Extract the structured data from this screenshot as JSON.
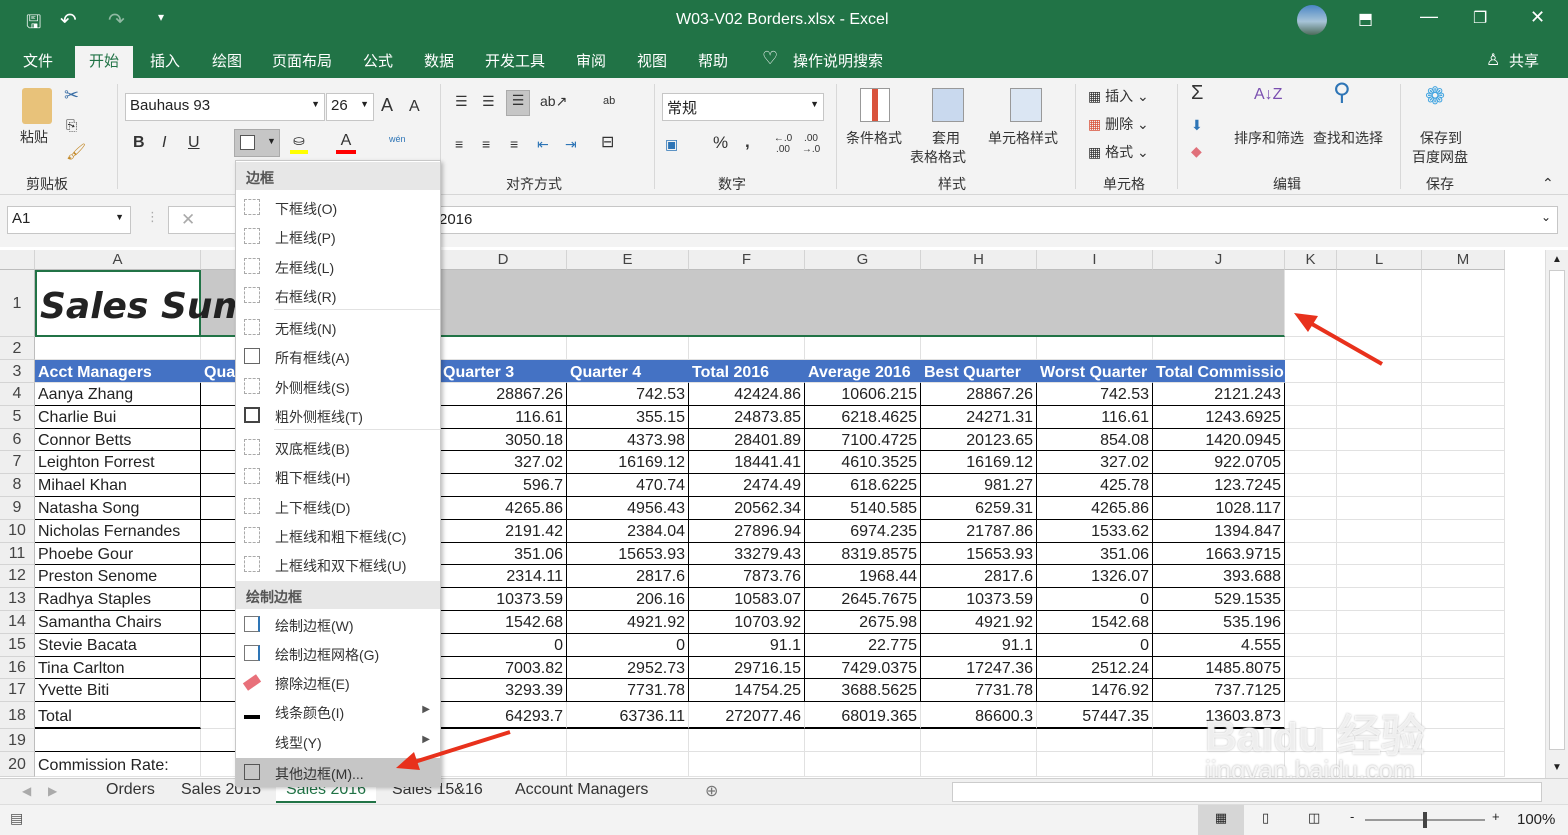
{
  "title_bar": {
    "title": "W03-V02 Borders.xlsx  -  Excel",
    "qat": [
      "save-icon",
      "undo-icon",
      "redo-icon",
      "customize-icon"
    ]
  },
  "ribbon_tabs": [
    "文件",
    "开始",
    "插入",
    "绘图",
    "页面布局",
    "公式",
    "数据",
    "开发工具",
    "审阅",
    "视图",
    "帮助"
  ],
  "tell_me": "操作说明搜索",
  "share": "共享",
  "ribbon": {
    "clipboard": {
      "paste": "粘贴",
      "group": "剪贴板"
    },
    "font": {
      "name": "Bauhaus 93",
      "size": "26",
      "bold": "B",
      "italic": "I",
      "underline": "U",
      "grow": "A",
      "shrink": "A",
      "phonetic": "wén",
      "fill_color": "#ffff00",
      "font_color": "#ff0000"
    },
    "alignment": {
      "group": "对齐方式",
      "wrap": "ab"
    },
    "number": {
      "format": "常规",
      "group": "数字",
      "percent": "%",
      "comma": "9",
      "inc": "←.0 .00",
      "dec": ".00 →.0"
    },
    "styles": {
      "conditional": "条件格式",
      "table1": "套用",
      "table2": "表格格式",
      "cell_styles": "单元格样式",
      "group": "样式"
    },
    "cells": {
      "insert": "插入",
      "delete": "删除",
      "format": "格式",
      "group": "单元格"
    },
    "editing": {
      "sum": "Σ",
      "sort": "排序和筛选",
      "find": "查找和选择",
      "group": "编辑"
    },
    "save": {
      "label1": "保存到",
      "label2": "百度网盘",
      "group": "保存"
    }
  },
  "formula_bar": {
    "name_box": "A1",
    "formula_visible": "2016"
  },
  "columns": [
    "A",
    "B",
    "C",
    "D",
    "E",
    "F",
    "G",
    "H",
    "I",
    "J",
    "K",
    "L",
    "M"
  ],
  "rows": [
    "1",
    "2",
    "3",
    "4",
    "5",
    "6",
    "7",
    "8",
    "9",
    "10",
    "11",
    "12",
    "13",
    "14",
    "15",
    "16",
    "17",
    "18",
    "19",
    "20"
  ],
  "sheet": {
    "title": "Sales Summ",
    "header": [
      "Acct Managers",
      "Qua",
      "",
      "Quarter 3",
      "Quarter 4",
      "Total 2016",
      "Average 2016",
      "Best Quarter",
      "Worst Quarter",
      "Total Commission"
    ],
    "header_color": "#4472c4",
    "data": [
      [
        "Aanya Zhang",
        "28867.26",
        "742.53",
        "42424.86",
        "10606.215",
        "28867.26",
        "742.53",
        "2121.243"
      ],
      [
        "Charlie Bui",
        "116.61",
        "355.15",
        "24873.85",
        "6218.4625",
        "24271.31",
        "116.61",
        "1243.6925"
      ],
      [
        "Connor Betts",
        "3050.18",
        "4373.98",
        "28401.89",
        "7100.4725",
        "20123.65",
        "854.08",
        "1420.0945"
      ],
      [
        "Leighton Forrest",
        "327.02",
        "16169.12",
        "18441.41",
        "4610.3525",
        "16169.12",
        "327.02",
        "922.0705"
      ],
      [
        "Mihael Khan",
        "596.7",
        "470.74",
        "2474.49",
        "618.6225",
        "981.27",
        "425.78",
        "123.7245"
      ],
      [
        "Natasha Song",
        "4265.86",
        "4956.43",
        "20562.34",
        "5140.585",
        "6259.31",
        "4265.86",
        "1028.117"
      ],
      [
        "Nicholas Fernandes",
        "2191.42",
        "2384.04",
        "27896.94",
        "6974.235",
        "21787.86",
        "1533.62",
        "1394.847"
      ],
      [
        "Phoebe Gour",
        "351.06",
        "15653.93",
        "33279.43",
        "8319.8575",
        "15653.93",
        "351.06",
        "1663.9715"
      ],
      [
        "Preston Senome",
        "2314.11",
        "2817.6",
        "7873.76",
        "1968.44",
        "2817.6",
        "1326.07",
        "393.688"
      ],
      [
        "Radhya Staples",
        "10373.59",
        "206.16",
        "10583.07",
        "2645.7675",
        "10373.59",
        "0",
        "529.1535"
      ],
      [
        "Samantha Chairs",
        "1542.68",
        "4921.92",
        "10703.92",
        "2675.98",
        "4921.92",
        "1542.68",
        "535.196"
      ],
      [
        "Stevie Bacata",
        "0",
        "0",
        "91.1",
        "22.775",
        "91.1",
        "0",
        "4.555"
      ],
      [
        "Tina Carlton",
        "7003.82",
        "2952.73",
        "29716.15",
        "7429.0375",
        "17247.36",
        "2512.24",
        "1485.8075"
      ],
      [
        "Yvette Biti",
        "3293.39",
        "7731.78",
        "14754.25",
        "3688.5625",
        "7731.78",
        "1476.92",
        "737.7125"
      ]
    ],
    "total": [
      "Total",
      "64293.7",
      "63736.11",
      "272077.46",
      "68019.365",
      "86600.3",
      "57447.35",
      "13603.873"
    ],
    "commission_label": "Commission Rate:"
  },
  "border_menu": {
    "header": "边框",
    "items": [
      "下框线(O)",
      "上框线(P)",
      "左框线(L)",
      "右框线(R)",
      "无框线(N)",
      "所有框线(A)",
      "外侧框线(S)",
      "粗外侧框线(T)",
      "双底框线(B)",
      "粗下框线(H)",
      "上下框线(D)",
      "上框线和粗下框线(C)",
      "上框线和双下框线(U)"
    ],
    "draw_header": "绘制边框",
    "draw_items": [
      "绘制边框(W)",
      "绘制边框网格(G)",
      "擦除边框(E)",
      "线条颜色(I)",
      "线型(Y)",
      "其他边框(M)..."
    ]
  },
  "sheet_tabs": [
    "Orders",
    "Sales 2015",
    "Sales 2016",
    "Sales 15&16",
    "Account Managers"
  ],
  "active_sheet": "Sales 2016",
  "zoom": "100%",
  "watermark": "Baidu经验 jingyan.baidu.com"
}
